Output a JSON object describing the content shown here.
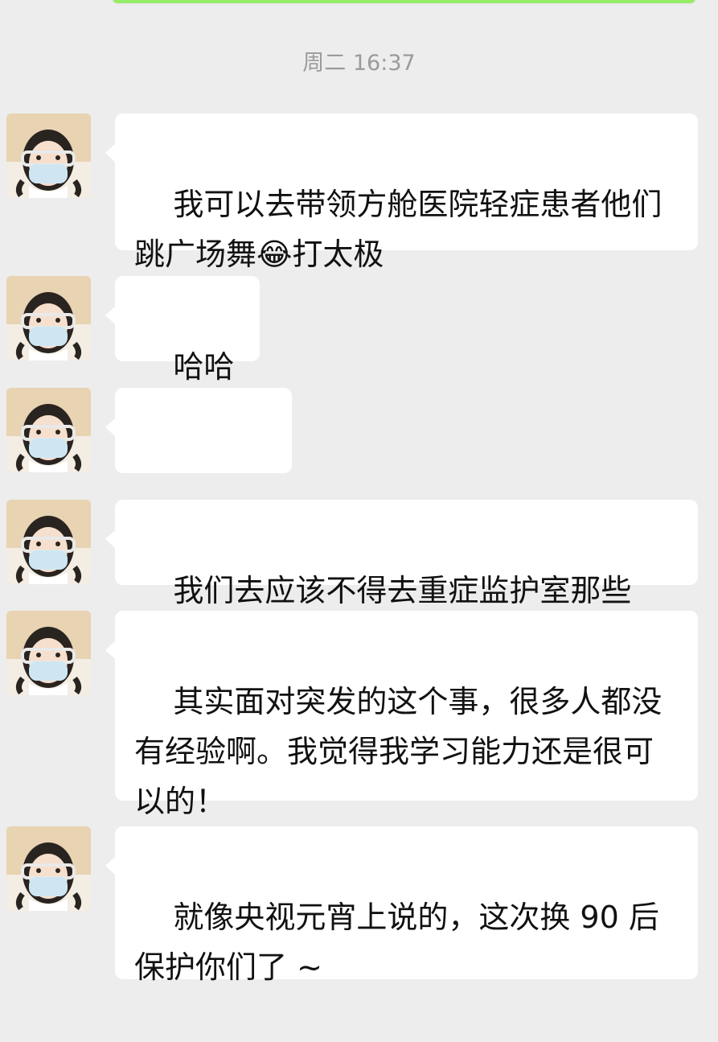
{
  "timestamp": "周二 16:37",
  "messages": [
    {
      "text": "我可以去带领方舱医院轻症患者他们跳广场舞😂打太极"
    },
    {
      "text": "哈哈哈"
    },
    {
      "emojis": [
        "facepalm-crying-emoji",
        "facepalm-crying-emoji",
        "facepalm-crying-emoji"
      ]
    },
    {
      "text": "我们去应该不得去重症监护室那些"
    },
    {
      "text": "其实面对突发的这个事，很多人都没有经验啊。我觉得我学习能力还是很可以的！"
    },
    {
      "text": "就像央视元宵上说的，这次换 90 后保护你们了 ~"
    }
  ],
  "colors": {
    "background": "#ededed",
    "incoming_bubble": "#ffffff",
    "outgoing_bubble": "#95ec69",
    "timestamp_text": "#9b9b9b"
  },
  "icons": {
    "avatar": "girl-with-mask-avatar",
    "emoji": "facepalm-crying-emoji"
  }
}
